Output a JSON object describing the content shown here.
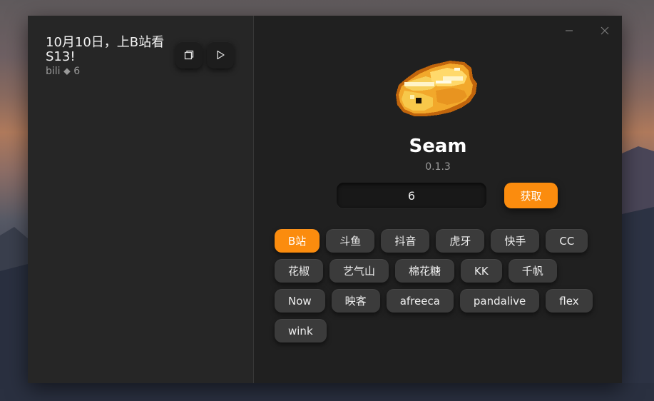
{
  "sidebar": {
    "items": [
      {
        "title": "10月10日，上B站看S13!",
        "meta": "bili ⬥ 6"
      }
    ],
    "icons": {
      "copy": "copy-icon",
      "play": "play-icon"
    }
  },
  "window_controls": {
    "minimize": "minimize-icon",
    "close": "close-icon"
  },
  "app": {
    "name": "Seam",
    "version": "0.1.3",
    "logo": "gold-ingot-logo"
  },
  "search": {
    "value": "6",
    "button_label": "获取"
  },
  "platforms": {
    "selected": "B站",
    "items": [
      "B站",
      "斗鱼",
      "抖音",
      "虎牙",
      "快手",
      "CC",
      "花椒",
      "艺气山",
      "棉花糖",
      "KK",
      "千帆",
      "Now",
      "映客",
      "afreeca",
      "pandalive",
      "flex",
      "wink"
    ]
  },
  "colors": {
    "accent": "#fb8c0e",
    "window_bg": "#202020",
    "sidebar_bg": "#262626",
    "chip_bg": "#3b3b3b"
  }
}
